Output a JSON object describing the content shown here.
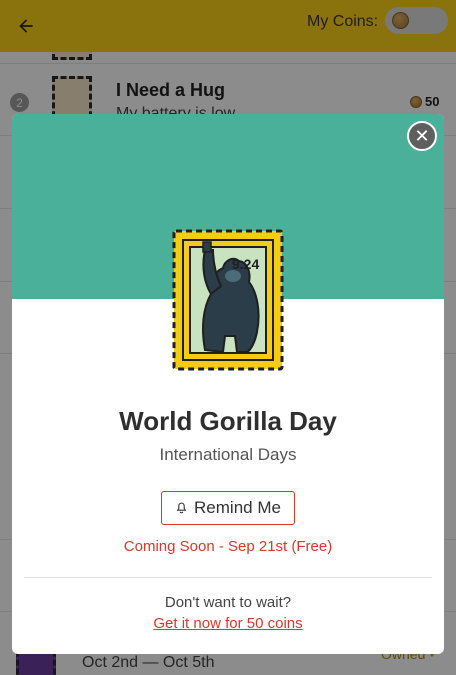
{
  "header": {
    "coins_label": "My Coins:",
    "back_icon": "arrow-left-icon",
    "coin_icon": "coin-icon"
  },
  "list": {
    "rows": [
      {
        "rank": "2",
        "title": "I Need a Hug",
        "subtitle": "My battery is low",
        "price": "50"
      },
      {
        "title": "",
        "subtitle": "Oct 2nd — Oct 5th",
        "status": "Owned"
      }
    ]
  },
  "modal": {
    "stamp_text": "9.24",
    "title": "World Gorilla Day",
    "subtitle": "International Days",
    "remind_label": "Remind Me",
    "coming_soon": "Coming Soon - Sep 21st (Free)",
    "dont_wait": "Don't want to wait?",
    "get_now": "Get it now for 50 coins",
    "close_icon": "close-icon",
    "bell_icon": "bell-icon"
  },
  "colors": {
    "header_bg": "#fcd116",
    "accent_red": "#d23a2a",
    "hero_green": "#4ab09a",
    "stamp_yellow": "#f5cc14"
  }
}
